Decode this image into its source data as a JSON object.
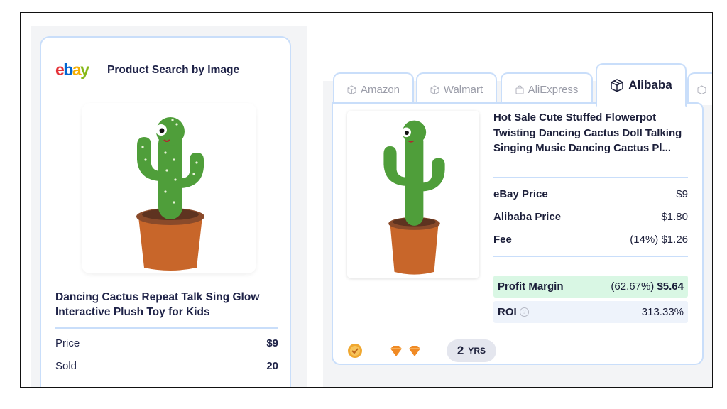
{
  "left_panel": {
    "logo_letters": [
      "e",
      "b",
      "a",
      "y"
    ],
    "title": "Product Search by Image",
    "product_image_icon": "dancing-cactus-icon",
    "product_title": "Dancing Cactus Repeat Talk Sing Glow Interactive Plush Toy for Kids",
    "rows": [
      {
        "label": "Price",
        "value": "$9"
      },
      {
        "label": "Sold",
        "value": "20"
      }
    ]
  },
  "tabs": [
    {
      "label": "Amazon",
      "icon": "box-icon",
      "active": false
    },
    {
      "label": "Walmart",
      "icon": "box-icon",
      "active": false
    },
    {
      "label": "AliExpress",
      "icon": "bag-icon",
      "active": false
    },
    {
      "label": "Alibaba",
      "icon": "box-icon",
      "active": true
    }
  ],
  "right_panel": {
    "product_title": "Hot Sale Cute Stuffed Flowerpot Twisting Dancing Cactus Doll Talking Singing Music Dancing Cactus Pl...",
    "rows": [
      {
        "label": "eBay Price",
        "value": "$9"
      },
      {
        "label": "Alibaba Price",
        "value": "$1.80"
      },
      {
        "label": "Fee",
        "value": "(14%) $1.26"
      }
    ],
    "profit_margin": {
      "label": "Profit Margin",
      "percent": "(62.67%)",
      "value": "$5.64"
    },
    "roi": {
      "label": "ROI",
      "help": "?",
      "value": "313.33%"
    },
    "badges": {
      "supplier_badge_icon": "verified-badge-icon",
      "diamond_count": 2,
      "years_num": "2",
      "years_unit": "YRS"
    }
  },
  "colors": {
    "accent_border": "#c9defa",
    "profit_bg": "#d9f7e4",
    "roi_bg": "#eef3fb",
    "diamond": "#f08a24",
    "cactus": "#4f9e3a",
    "pot": "#c8662a"
  }
}
